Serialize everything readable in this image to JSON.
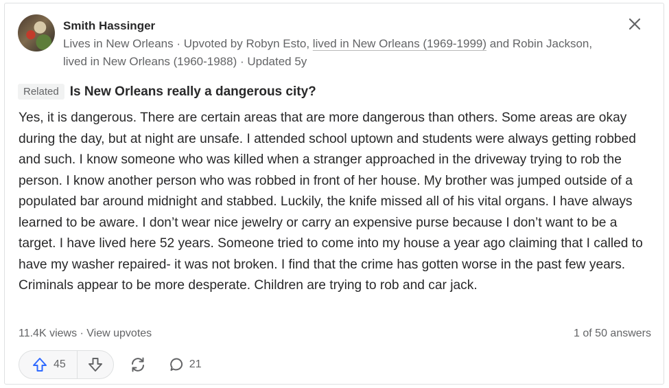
{
  "author": {
    "name": "Smith Hassinger",
    "credential_prefix": "Lives in New Orleans · Upvoted by Robyn Esto,",
    "credential_link1": "lived in New Orleans (1969-1999)",
    "credential_mid": "and Robin Jackson,",
    "credential_line2": "lived in New Orleans (1960-1988) · Updated 5y"
  },
  "related": {
    "tag": "Related",
    "question": "Is New Orleans really a dangerous city?"
  },
  "answer": {
    "text": "Yes, it is dangerous. There are certain areas that are more dangerous than others. Some areas are okay during the day, but at night are unsafe. I attended school uptown and students were always getting robbed and such. I know someone who was killed when a stranger approached in the driveway trying to rob the person. I know another person who was robbed in front of her house. My brother was jumped outside of a populated bar around midnight and stabbed. Luckily, the knife missed all of his vital organs. I have always learned to be aware. I don’t wear nice jewelry or carry an expensive purse because I don’t want to be a target. I have lived here 52 years. Someone tried to come into my house a year ago claiming that I called to have my washer repaired- it was not broken. I find that the crime has gotten worse in the past few years. Criminals appear to be more desperate. Children are trying to rob and car jack."
  },
  "meta": {
    "views": "11.4K views",
    "separator": " · ",
    "view_upvotes": "View upvotes",
    "position": "1 of 50 answers"
  },
  "actions": {
    "upvotes": "45",
    "comments": "21"
  },
  "icons": {
    "close": "close-icon",
    "upvote": "upvote-arrow-icon",
    "downvote": "downvote-arrow-icon",
    "share": "share-cycle-icon",
    "comment": "comment-bubble-icon"
  },
  "colors": {
    "accent": "#2e69ff",
    "muted": "#636466"
  }
}
